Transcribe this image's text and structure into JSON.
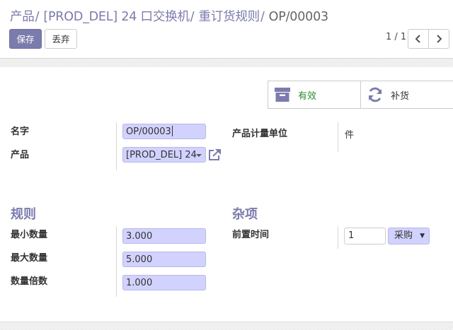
{
  "breadcrumb": [
    {
      "label": "产品"
    },
    {
      "label": "[PROD_DEL] 24 口交换机"
    },
    {
      "label": "重订货规则"
    }
  ],
  "breadcrumb_separator": "/",
  "breadcrumb_current": "OP/00003",
  "buttons": {
    "save": "保存",
    "discard": "丢弃"
  },
  "pager": {
    "value": "1 / 1",
    "prev_icon": "chevron-left-icon",
    "next_icon": "chevron-right-icon"
  },
  "smart_buttons": {
    "active": {
      "label": "有效",
      "icon": "archive-icon"
    },
    "replenish": {
      "label": "补货",
      "icon": "refresh-icon"
    }
  },
  "form": {
    "name": {
      "label": "名字",
      "value": "OP/00003"
    },
    "product": {
      "label": "产品",
      "value": "[PROD_DEL] 24",
      "link_icon": "external-link-icon"
    },
    "uom": {
      "label": "产品计量单位",
      "value": "件"
    },
    "rules_group": {
      "title": "规则",
      "min_qty": {
        "label": "最小数量",
        "value": "3.000"
      },
      "max_qty": {
        "label": "最大数量",
        "value": "5.000"
      },
      "qty_multiple": {
        "label": "数量倍数",
        "value": "1.000"
      }
    },
    "misc_group": {
      "title": "杂项",
      "lead_time": {
        "label": "前置时间",
        "value": "1",
        "unit": "采购"
      }
    }
  },
  "colors": {
    "brand": "#7c7bad",
    "field_bg": "#d2d2ff",
    "active_green": "#2c8b2c"
  }
}
